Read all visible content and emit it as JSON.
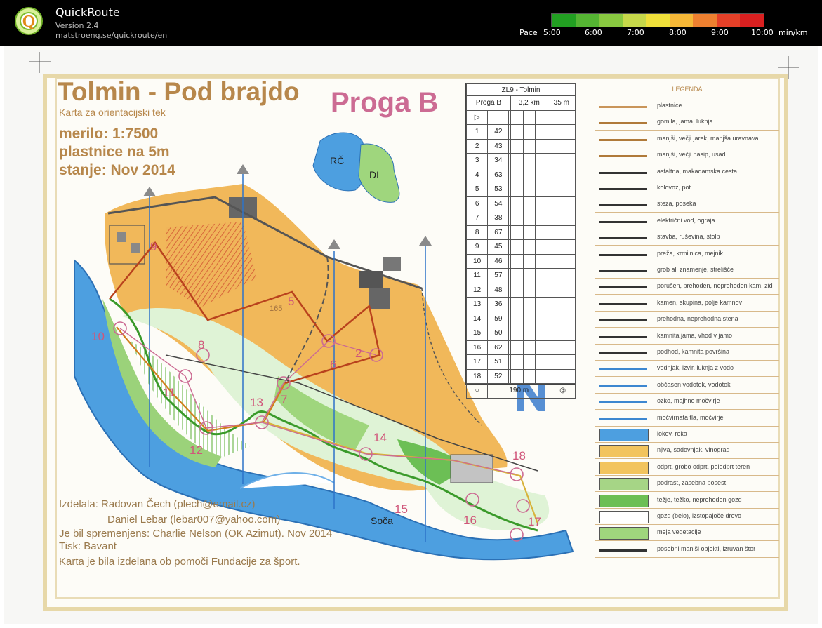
{
  "app": {
    "title": "QuickRoute",
    "version": "Version 2.4",
    "url": "matstroeng.se/quickroute/en"
  },
  "pace_scale": {
    "label": "Pace",
    "ticks": [
      "5:00",
      "6:00",
      "7:00",
      "8:00",
      "9:00",
      "10:00"
    ],
    "unit": "min/km",
    "colors": [
      "#22a022",
      "#55b533",
      "#88c840",
      "#c6d84a",
      "#f0e03a",
      "#f5b737",
      "#ee8030",
      "#e54028",
      "#d92020"
    ]
  },
  "map": {
    "title": "Tolmin - Pod brajdo",
    "subtitle": "Karta za orientacijski tek",
    "scale": "merilo: 1:7500",
    "contour": "plastnice na 5m",
    "status": "stanje: Nov 2014",
    "course": "Proga B",
    "lakes": [
      "RČ",
      "DL"
    ],
    "river": "Soča",
    "contour_label": "165",
    "credits": [
      "Izdelala: Radovan Čech (plech@email.cz)",
      "Daniel Lebar (lebar007@yahoo.com)",
      "Je bil spremenjens: Charlie Nelson (OK Azimut). Nov 2014",
      "Tisk: Bavant",
      "Karta je bila izdelana ob pomoči Fundacije za šport."
    ],
    "controls": [
      {
        "n": "2"
      },
      {
        "n": "5"
      },
      {
        "n": "6"
      },
      {
        "n": "7"
      },
      {
        "n": "8"
      },
      {
        "n": "9"
      },
      {
        "n": "10"
      },
      {
        "n": "11"
      },
      {
        "n": "12"
      },
      {
        "n": "13"
      },
      {
        "n": "14"
      },
      {
        "n": "15"
      },
      {
        "n": "16"
      },
      {
        "n": "17"
      },
      {
        "n": "18"
      }
    ]
  },
  "description_sheet": {
    "event": "ZL9 - Tolmin",
    "course": "Proga B",
    "length": "3,2 km",
    "climb": "35 m",
    "rows": [
      {
        "n": "1",
        "code": "42"
      },
      {
        "n": "2",
        "code": "43"
      },
      {
        "n": "3",
        "code": "34"
      },
      {
        "n": "4",
        "code": "63"
      },
      {
        "n": "5",
        "code": "53"
      },
      {
        "n": "6",
        "code": "54"
      },
      {
        "n": "7",
        "code": "38"
      },
      {
        "n": "8",
        "code": "67"
      },
      {
        "n": "9",
        "code": "45"
      },
      {
        "n": "10",
        "code": "46"
      },
      {
        "n": "11",
        "code": "57"
      },
      {
        "n": "12",
        "code": "48"
      },
      {
        "n": "13",
        "code": "36"
      },
      {
        "n": "14",
        "code": "59"
      },
      {
        "n": "15",
        "code": "50"
      },
      {
        "n": "16",
        "code": "62"
      },
      {
        "n": "17",
        "code": "51"
      },
      {
        "n": "18",
        "code": "52"
      }
    ],
    "finish": "190 m"
  },
  "legend": {
    "title": "LEGENDA",
    "items": [
      {
        "label": "plastnice",
        "icon": "contour-icon"
      },
      {
        "label": "gomila, jama, luknja",
        "icon": "knoll-pit-icon"
      },
      {
        "label": "manjši, večji jarek, manjša uravnava",
        "icon": "ditch-icon"
      },
      {
        "label": "manjši, večji nasip, usad",
        "icon": "earth-bank-icon"
      },
      {
        "label": "asfaltna, makadamska cesta",
        "icon": "road-icon"
      },
      {
        "label": "kolovoz, pot",
        "icon": "track-icon"
      },
      {
        "label": "steza, poseka",
        "icon": "path-icon"
      },
      {
        "label": "električni vod, ograja",
        "icon": "power-line-icon"
      },
      {
        "label": "stavba, ruševina, stolp",
        "icon": "building-icon"
      },
      {
        "label": "preža, krmilnica, mejnik",
        "icon": "high-seat-icon"
      },
      {
        "label": "grob ali znamenje, strelišče",
        "icon": "grave-icon"
      },
      {
        "label": "porušen, prehoden, neprehoden kam. zid",
        "icon": "stone-wall-icon"
      },
      {
        "label": "kamen, skupina, polje kamnov",
        "icon": "boulder-icon"
      },
      {
        "label": "prehodna, neprehodna stena",
        "icon": "cliff-icon"
      },
      {
        "label": "kamnita jama, vhod v jamo",
        "icon": "cave-icon"
      },
      {
        "label": "podhod, kamnita površina",
        "icon": "tunnel-icon"
      },
      {
        "label": "vodnjak, izvir, luknja z vodo",
        "icon": "well-icon"
      },
      {
        "label": "občasen vodotok, vodotok",
        "icon": "stream-icon"
      },
      {
        "label": "ozko, majhno močvirje",
        "icon": "narrow-marsh-icon"
      },
      {
        "label": "močvirnata tla, močvirje",
        "icon": "marsh-icon"
      },
      {
        "label": "lokev, reka",
        "icon": "water-icon"
      },
      {
        "label": "njiva, sadovnjak, vinograd",
        "icon": "field-icon"
      },
      {
        "label": "odprt, grobo odprt, polodprt teren",
        "icon": "open-land-icon"
      },
      {
        "label": "podrast, zasebna posest",
        "icon": "undergrowth-icon"
      },
      {
        "label": "težje, težko, neprehoden gozd",
        "icon": "forest-icon"
      },
      {
        "label": "gozd (belo), izstopajoče drevo",
        "icon": "white-forest-icon"
      },
      {
        "label": "meja vegetacije",
        "icon": "vegetation-boundary-icon"
      },
      {
        "label": "posebni manjši objekti, izruvan štor",
        "icon": "special-object-icon"
      }
    ]
  }
}
